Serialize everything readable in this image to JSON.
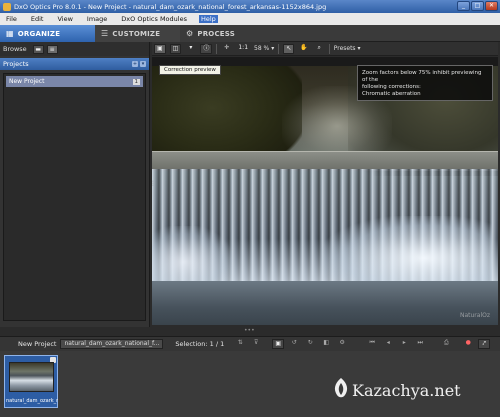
{
  "window": {
    "title": "DxO Optics Pro 8.0.1 - New Project - natural_dam_ozark_national_forest_arkansas-1152x864.jpg",
    "buttons": {
      "minimize": "_",
      "maximize": "□",
      "close": "✕"
    }
  },
  "menu": {
    "items": [
      "File",
      "Edit",
      "View",
      "Image",
      "DxO Optics Modules",
      "Help"
    ],
    "active": "Help"
  },
  "modules": {
    "organize": "ORGANIZE",
    "customize": "CUSTOMIZE",
    "process": "PROCESS"
  },
  "browse": {
    "label": "Browse"
  },
  "projects": {
    "header": "Projects",
    "items": [
      {
        "name": "New Project",
        "count": "1"
      }
    ]
  },
  "image_toolbar": {
    "fit_label": "1:1",
    "zoom": "58 %",
    "presets": "Presets"
  },
  "viewer": {
    "tooltip": "Correction preview",
    "info_lines": [
      "Zoom factors below 75% inhibit previewing of the",
      "following corrections:",
      "Chromatic aberration"
    ],
    "watermark": "NaturalOz"
  },
  "filmstrip_bar": {
    "project": "New Project",
    "filename": "natural_dam_ozark_national_f...",
    "selection": "Selection: 1 / 1"
  },
  "filmstrip": {
    "thumbs": [
      {
        "caption": "natural_dam_ozark_nat"
      }
    ]
  },
  "brand": {
    "text": "Kazachya.net"
  }
}
